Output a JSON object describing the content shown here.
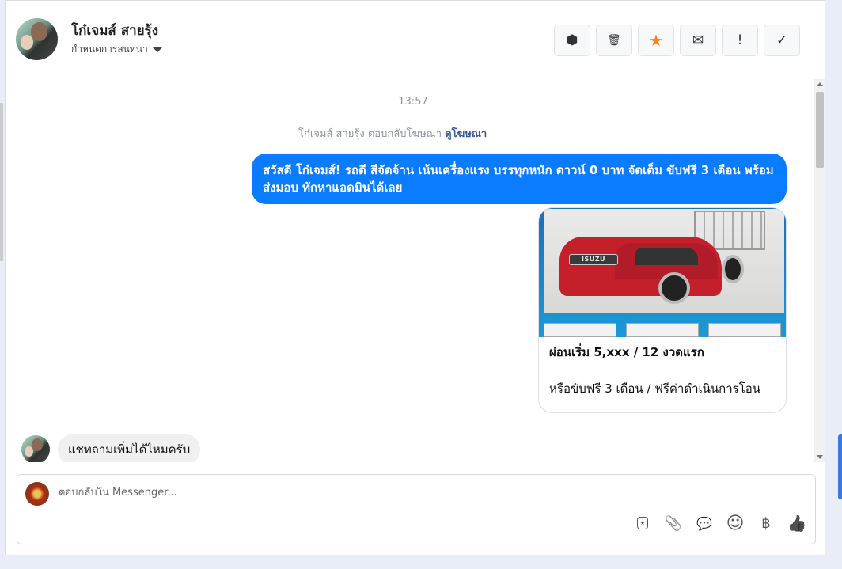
{
  "header": {
    "contact_name": "โก๋เจมส์ สายรุ้ง",
    "subtitle": "กำหนดการสนทนา",
    "tools": [
      {
        "icon": "alert-octagon-icon",
        "glyph": "⬢"
      },
      {
        "icon": "trash-icon",
        "glyph": "🗑"
      },
      {
        "icon": "star-icon",
        "glyph": "★",
        "color": "#f5832a"
      },
      {
        "icon": "envelope-icon",
        "glyph": "✉"
      },
      {
        "icon": "exclamation-icon",
        "glyph": "!"
      },
      {
        "icon": "check-icon",
        "glyph": "✓"
      }
    ]
  },
  "chat": {
    "timestamp": "13:57",
    "reply_note": "โก๋เจมส์ สายรุ้ง ตอบกลับโฆษณา",
    "view_ad_link": "ดูโฆษณา",
    "outgoing_message": "สวัสดี โก๋เจมส์! รถดี สีจัดจ้าน เน้นเครื่องแรง บรรทุกหนัก ดาวน์ 0 บาท จัดเต็ม ขับฟรี 3 เดือน พร้อมส่งมอบ ทักหาแอดมินได้เลย",
    "ad_card": {
      "title": "ผ่อนเริ่ม 5,xxx / 12 งวดแรก",
      "description": "หรือขับฟรี 3 เดือน / ฟรีค่าดำเนินการโอน",
      "brand_text": "ISUZU"
    },
    "incoming_message": "แชทถามเพิ่มได้ไหมครับ"
  },
  "composer": {
    "placeholder": "ตอบกลับใน Messenger...",
    "icons": [
      {
        "icon": "saved-reply-icon",
        "glyph": "⭑"
      },
      {
        "icon": "paperclip-icon",
        "glyph": "📎"
      },
      {
        "icon": "chat-bubble-icon",
        "glyph": "💬"
      },
      {
        "icon": "emoji-icon",
        "glyph": "☺"
      },
      {
        "icon": "baht-icon",
        "glyph": "฿"
      },
      {
        "icon": "thumbs-up-icon",
        "glyph": "👍"
      }
    ]
  },
  "colors": {
    "accent": "#0a7cff",
    "star": "#f5832a",
    "link": "#385898"
  }
}
